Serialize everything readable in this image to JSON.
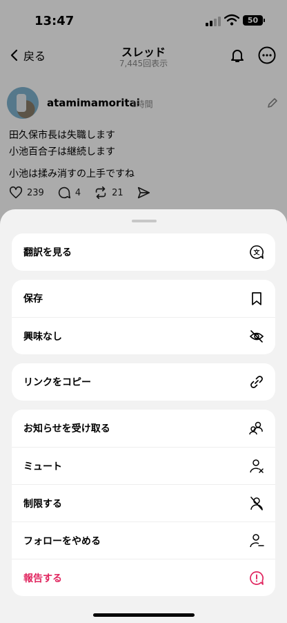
{
  "status": {
    "time": "13:47",
    "battery": "50"
  },
  "nav": {
    "back_label": "戻る",
    "title": "スレッド",
    "subtitle": "7,445回表示"
  },
  "post": {
    "username": "atamimamoritai",
    "age": "1時間",
    "lines": [
      "田久保市長は失職します",
      "小池百合子は継続します",
      "小池は揉み消すの上手ですね"
    ],
    "likes": "239",
    "replies": "4",
    "reposts": "21"
  },
  "sheet": {
    "groups": [
      [
        {
          "label": "翻訳を見る",
          "icon": "translate-icon"
        }
      ],
      [
        {
          "label": "保存",
          "icon": "bookmark-icon"
        },
        {
          "label": "興味なし",
          "icon": "eye-off-icon"
        }
      ],
      [
        {
          "label": "リンクをコピー",
          "icon": "link-icon"
        }
      ],
      [
        {
          "label": "お知らせを受け取る",
          "icon": "users-icon"
        },
        {
          "label": "ミュート",
          "icon": "user-x-icon"
        },
        {
          "label": "制限する",
          "icon": "user-slash-icon"
        },
        {
          "label": "フォローをやめる",
          "icon": "user-minus-icon"
        },
        {
          "label": "報告する",
          "icon": "report-icon"
        }
      ]
    ]
  },
  "colors": {
    "danger": "#e0245e",
    "sheet_bg": "#f2f2f2"
  }
}
